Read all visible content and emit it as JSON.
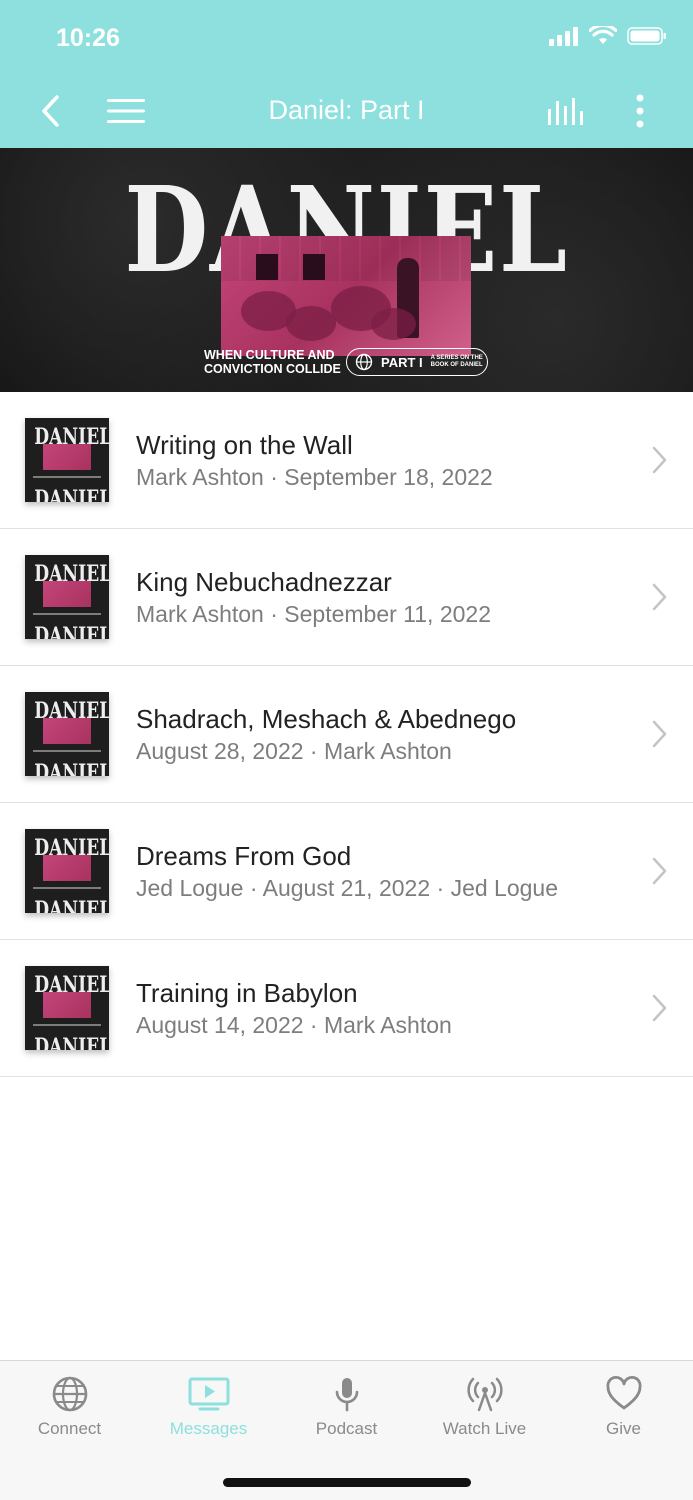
{
  "status": {
    "time": "10:26"
  },
  "nav": {
    "title": "Daniel: Part I",
    "back_icon": "chevron-left-icon",
    "menu_icon": "hamburger-menu-icon",
    "audio_icon": "audio-bars-icon",
    "more_icon": "vertical-dots-icon"
  },
  "banner": {
    "title": "DANIEL",
    "subtitle_line1": "WHEN CULTURE AND",
    "subtitle_line2": "CONVICTION COLLIDE",
    "part": "PART I",
    "series_line1": "A SERIES ON THE",
    "series_line2": "BOOK OF DANIEL"
  },
  "messages": [
    {
      "title": "Writing on the Wall",
      "subtitle": "Mark Ashton · September 18, 2022",
      "thumb_title": "DANIEL"
    },
    {
      "title": "King Nebuchadnezzar",
      "subtitle": "Mark Ashton · September 11, 2022",
      "thumb_title": "DANIEL"
    },
    {
      "title": "Shadrach, Meshach & Abednego",
      "subtitle": "August 28, 2022 · Mark Ashton",
      "thumb_title": "DANIEL"
    },
    {
      "title": "Dreams From God",
      "subtitle": "Jed Logue · August 21, 2022 · Jed Logue",
      "thumb_title": "DANIEL"
    },
    {
      "title": "Training in Babylon",
      "subtitle": "August 14, 2022 · Mark Ashton",
      "thumb_title": "DANIEL"
    }
  ],
  "tabs": [
    {
      "label": "Connect",
      "icon": "globe-icon",
      "active": false
    },
    {
      "label": "Messages",
      "icon": "tv-play-icon",
      "active": true
    },
    {
      "label": "Podcast",
      "icon": "microphone-icon",
      "active": false
    },
    {
      "label": "Watch Live",
      "icon": "broadcast-icon",
      "active": false
    },
    {
      "label": "Give",
      "icon": "heart-icon",
      "active": false
    }
  ],
  "colors": {
    "accent": "#8de0dd",
    "tab_inactive": "#8a8a8a",
    "banner_art": "#c4457a"
  }
}
